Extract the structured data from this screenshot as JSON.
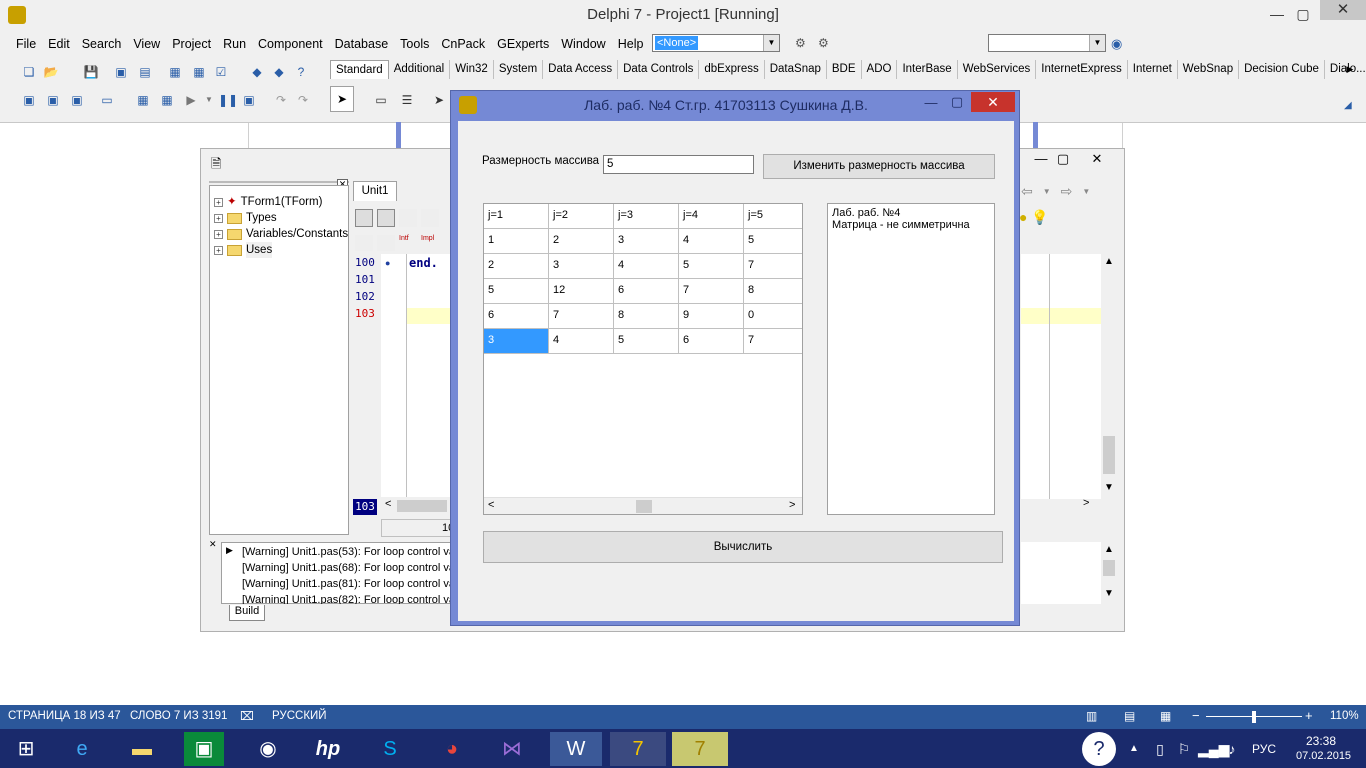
{
  "ide": {
    "title": "Delphi 7 - Project1 [Running]",
    "menu": [
      "File",
      "Edit",
      "Search",
      "View",
      "Project",
      "Run",
      "Component",
      "Database",
      "Tools",
      "CnPack",
      "GExperts",
      "Window",
      "Help"
    ],
    "combo_value": "<None>",
    "palette_tabs": [
      "Standard",
      "Additional",
      "Win32",
      "System",
      "Data Access",
      "Data Controls",
      "dbExpress",
      "DataSnap",
      "BDE",
      "ADO",
      "InterBase",
      "WebServices",
      "InternetExpress",
      "Internet",
      "WebSnap",
      "Decision Cube",
      "Dialo..."
    ]
  },
  "editor": {
    "tab": "Unit1",
    "tree": [
      "TForm1(TForm)",
      "Types",
      "Variables/Constants",
      "Uses"
    ],
    "line_numbers": [
      "100",
      "101",
      "102",
      "103"
    ],
    "code_line": "end.",
    "current_line": "103",
    "status_fragment": "10",
    "messages": [
      "[Warning] Unit1.pas(53): For loop control va",
      "[Warning] Unit1.pas(68): For loop control va",
      "[Warning] Unit1.pas(81): For loop control va",
      "[Warning] Unit1.pas(82): For loop control va"
    ],
    "messages_tab": "Build"
  },
  "dialog": {
    "title": "Лаб. раб. №4 Ст.гр.  41703113 Сушкина Д.В.",
    "size_label": "Размерность массива",
    "size_value": "5",
    "resize_button": "Изменить размерность массива",
    "compute_button": "Вычислить",
    "grid": {
      "headers": [
        "j=1",
        "j=2",
        "j=3",
        "j=4",
        "j=5"
      ],
      "rows": [
        [
          "1",
          "2",
          "3",
          "4",
          "5"
        ],
        [
          "2",
          "3",
          "4",
          "5",
          "7"
        ],
        [
          "5",
          "12",
          "6",
          "7",
          "8"
        ],
        [
          "6",
          "7",
          "8",
          "9",
          "0"
        ],
        [
          "3",
          "4",
          "5",
          "6",
          "7"
        ]
      ]
    },
    "memo_lines": [
      "Лаб. раб. №4",
      "Матрица - не симметрична"
    ]
  },
  "word_status": {
    "page": "СТРАНИЦА 18 ИЗ 47",
    "words": "СЛОВО 7 ИЗ 3191",
    "language": "РУССКИЙ",
    "zoom": "110%"
  },
  "taskbar": {
    "lang": "РУС",
    "time": "23:38",
    "date": "07.02.2015"
  }
}
